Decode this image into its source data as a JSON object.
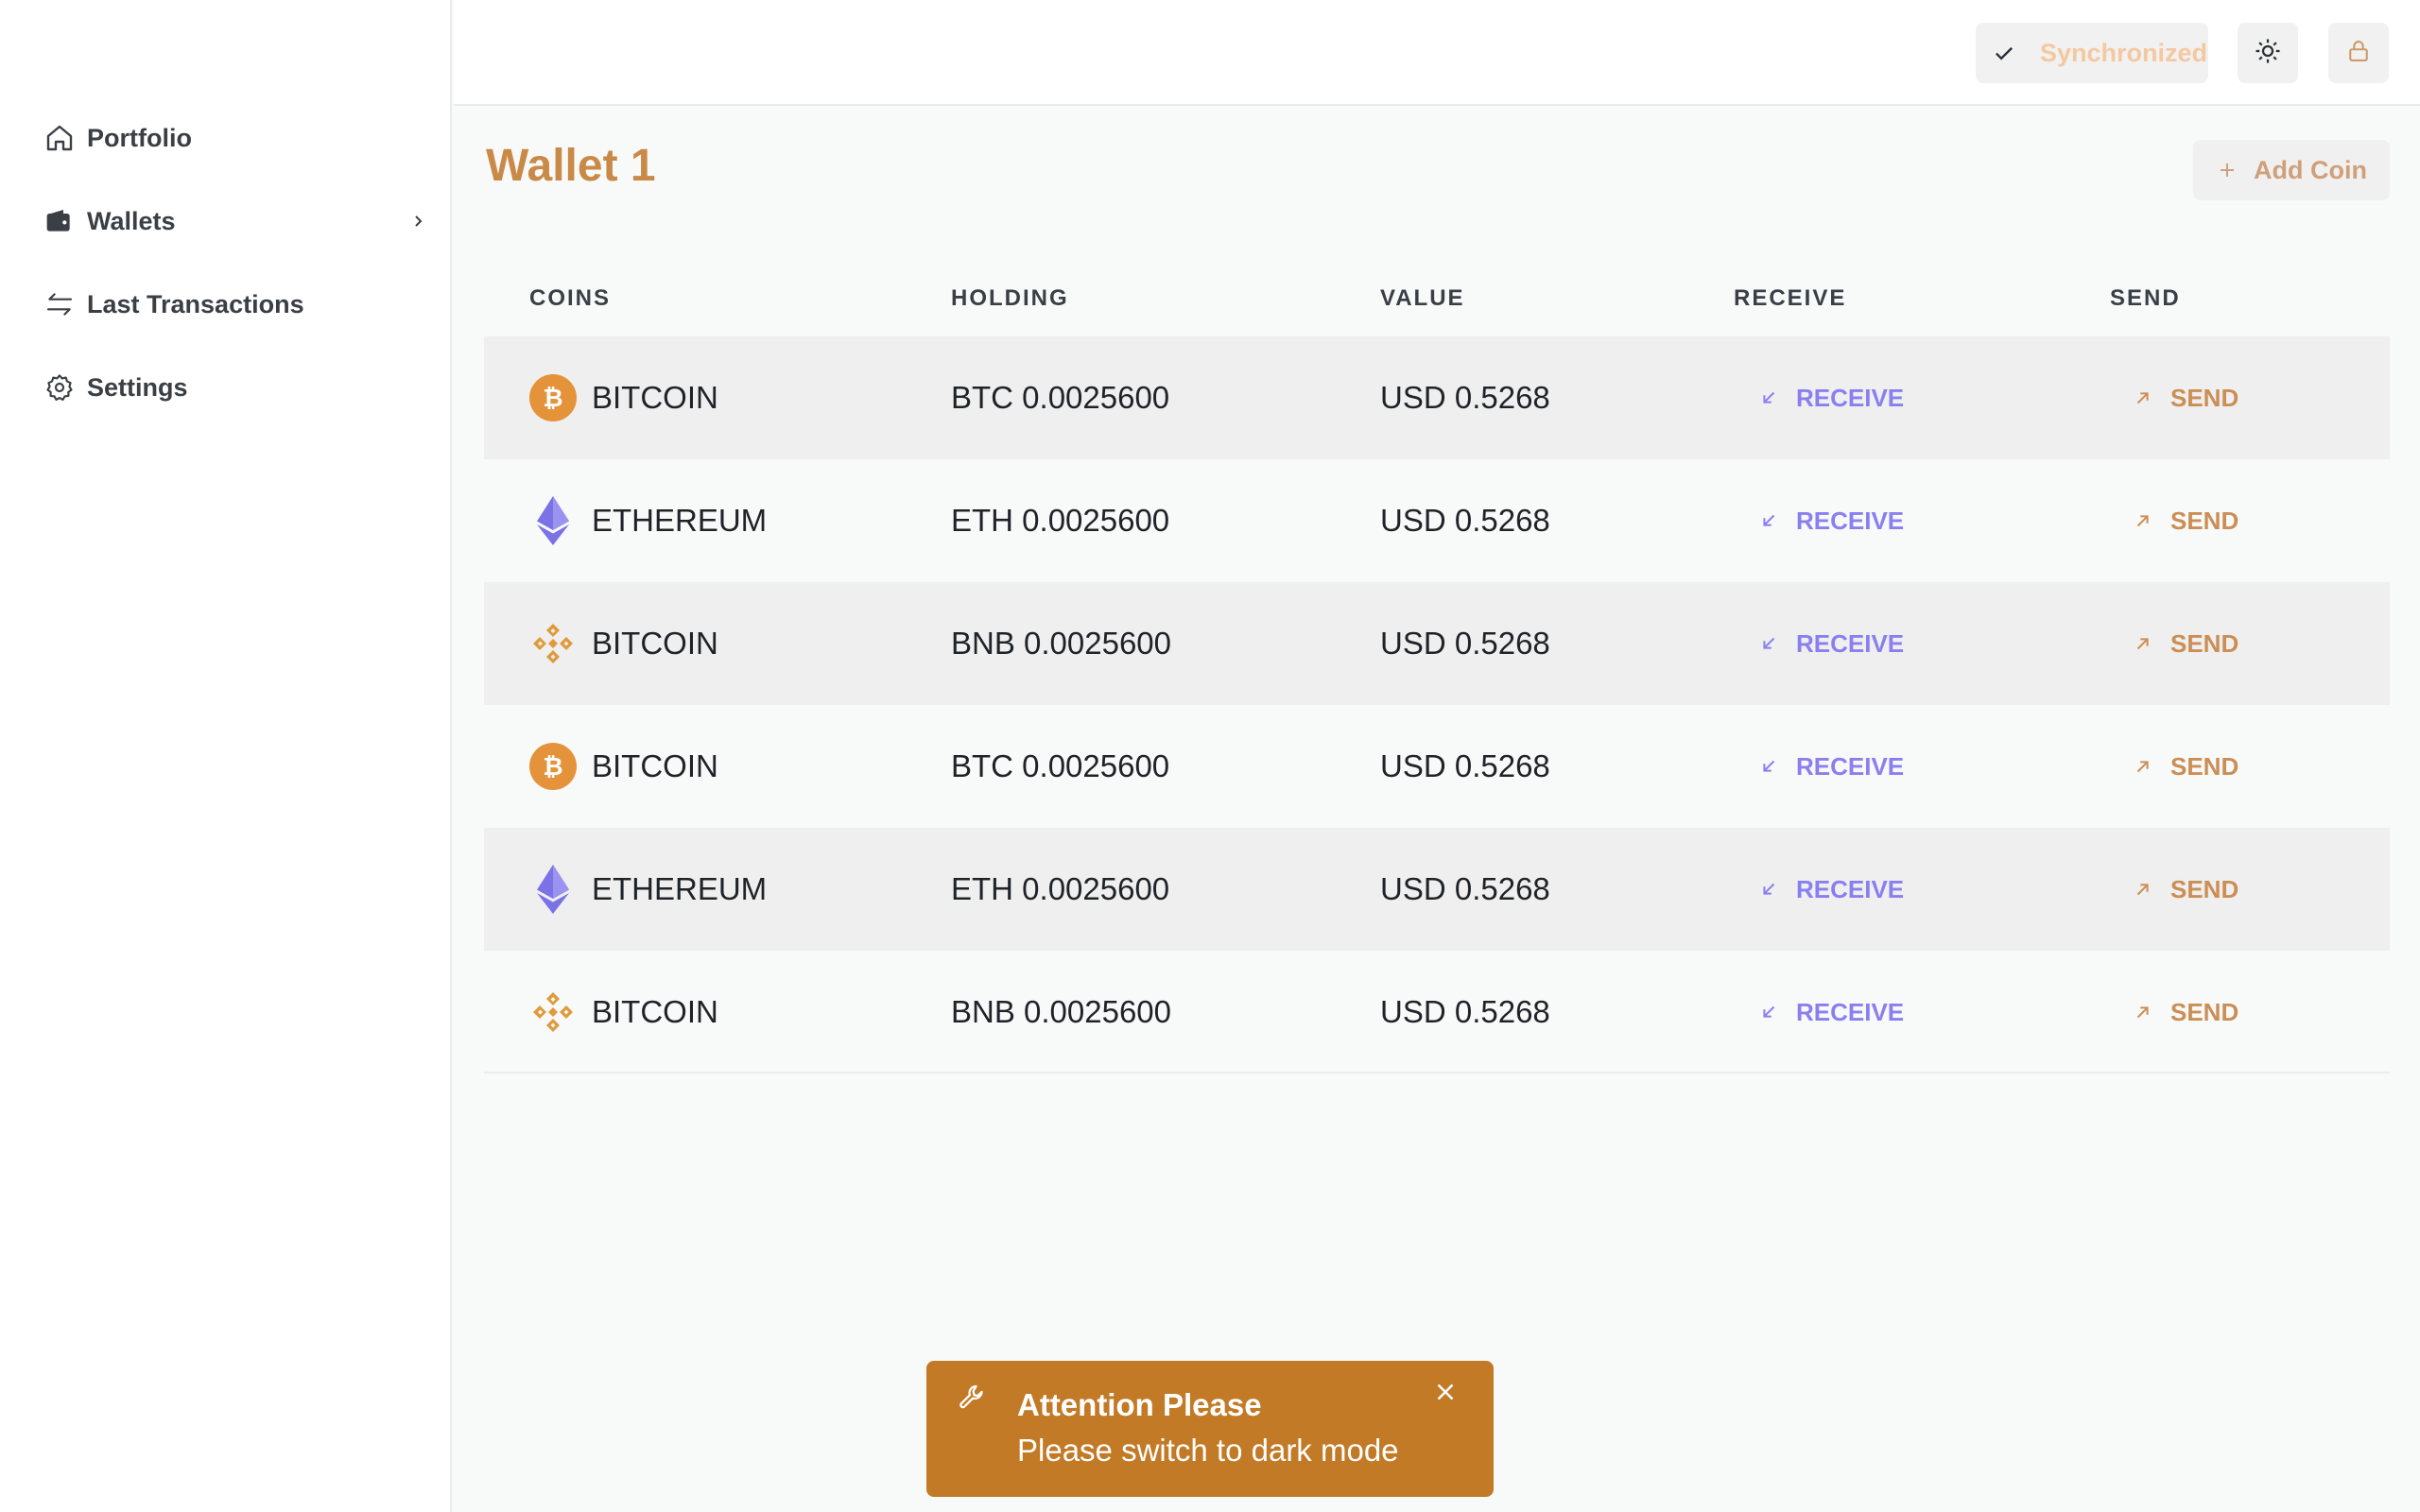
{
  "sidebar": {
    "items": [
      {
        "label": "Portfolio",
        "icon": "home-icon"
      },
      {
        "label": "Wallets",
        "icon": "wallet-icon"
      },
      {
        "label": "Last Transactions",
        "icon": "transfer-icon"
      },
      {
        "label": "Settings",
        "icon": "gear-icon"
      }
    ]
  },
  "topbar": {
    "sync_label": "Synchronized"
  },
  "main": {
    "title": "Wallet 1",
    "add_coin_label": "Add Coin",
    "columns": [
      "COINS",
      "HOLDING",
      "VALUE",
      "RECEIVE",
      "SEND"
    ],
    "rows": [
      {
        "coin": "BITCOIN",
        "logo": "bitcoin-logo",
        "holding": "BTC 0.0025600",
        "value": "USD 0.5268",
        "receive": "RECEIVE",
        "send": "SEND"
      },
      {
        "coin": "ETHEREUM",
        "logo": "ethereum-logo",
        "holding": "ETH 0.0025600",
        "value": "USD 0.5268",
        "receive": "RECEIVE",
        "send": "SEND"
      },
      {
        "coin": "BITCOIN",
        "logo": "binance-logo",
        "holding": "BNB 0.0025600",
        "value": "USD 0.5268",
        "receive": "RECEIVE",
        "send": "SEND"
      },
      {
        "coin": "BITCOIN",
        "logo": "bitcoin-logo",
        "holding": "BTC 0.0025600",
        "value": "USD 0.5268",
        "receive": "RECEIVE",
        "send": "SEND"
      },
      {
        "coin": "ETHEREUM",
        "logo": "ethereum-logo",
        "holding": "ETH 0.0025600",
        "value": "USD 0.5268",
        "receive": "RECEIVE",
        "send": "SEND"
      },
      {
        "coin": "BITCOIN",
        "logo": "binance-logo",
        "holding": "BNB 0.0025600",
        "value": "USD 0.5268",
        "receive": "RECEIVE",
        "send": "SEND"
      }
    ]
  },
  "toast": {
    "title": "Attention Please",
    "message": "Please switch to dark mode"
  },
  "colors": {
    "accent": "#c98a48",
    "receive": "#8a7ff0",
    "send": "#cb8e54",
    "toast": "#c27a26",
    "bitcoin": "#e5933a",
    "ethereum": "#7b72e6",
    "binance": "#e09a3c"
  }
}
